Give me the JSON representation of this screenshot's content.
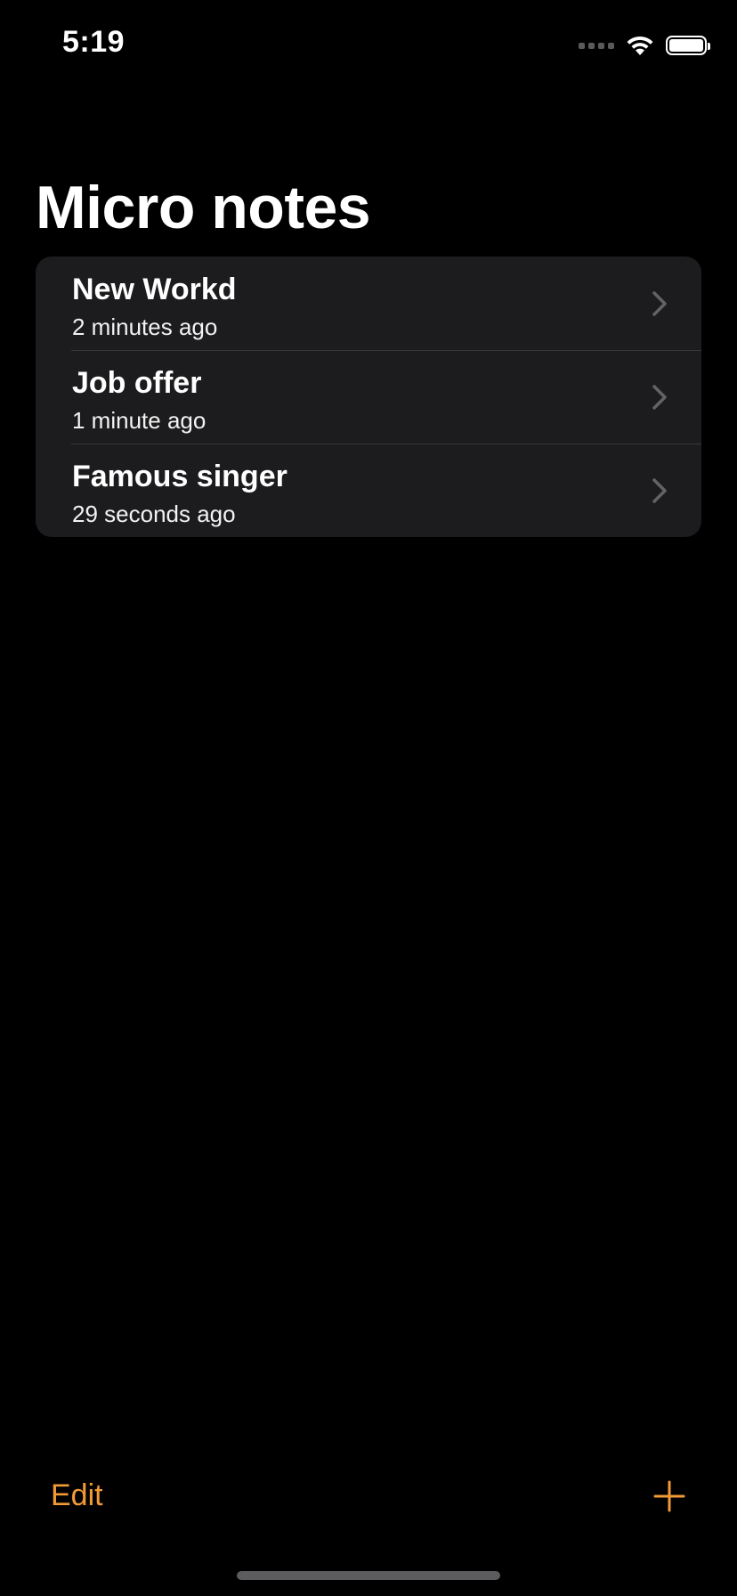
{
  "status_bar": {
    "time": "5:19",
    "icons": [
      "cellular-signal-icon",
      "wifi-icon",
      "battery-icon"
    ],
    "battery_level": 1.0
  },
  "page_title": "Micro notes",
  "notes": [
    {
      "title": "New Workd",
      "time": "2 minutes ago"
    },
    {
      "title": "Job offer",
      "time": "1 minute ago"
    },
    {
      "title": "Famous singer",
      "time": "29 seconds ago"
    }
  ],
  "toolbar": {
    "edit_label": "Edit",
    "add_icon": "plus-icon"
  },
  "colors": {
    "background": "#000000",
    "list_background": "#1c1c1e",
    "accent": "#f19a37",
    "separator": "#38383a",
    "chevron": "#636366"
  }
}
